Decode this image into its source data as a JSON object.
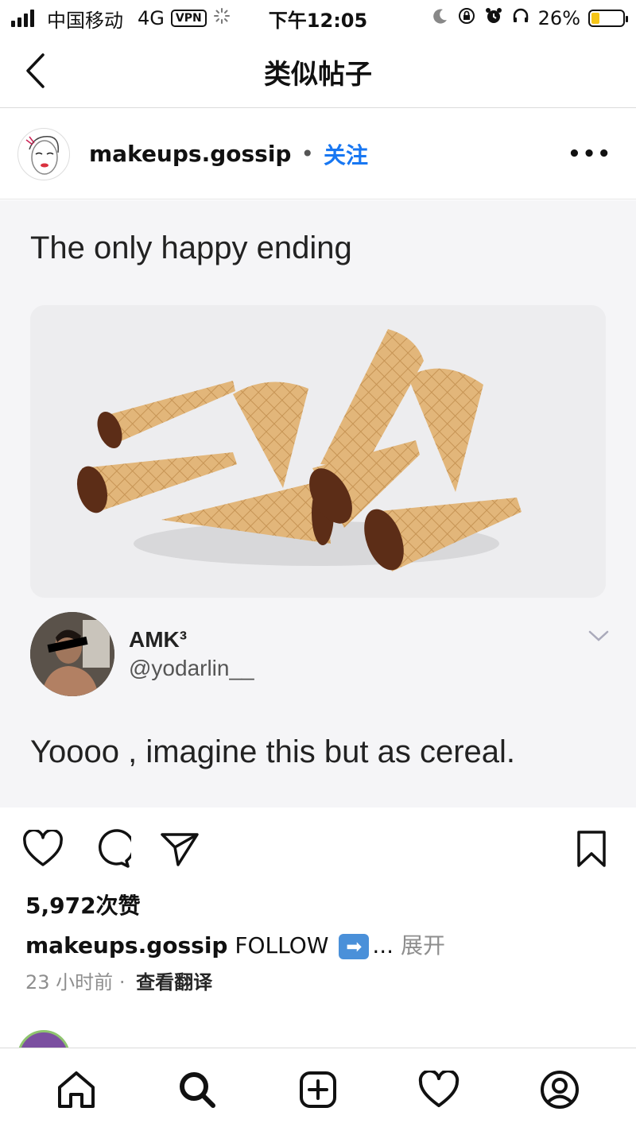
{
  "status_bar": {
    "carrier": "中国移动",
    "network": "4G",
    "vpn": "VPN",
    "time": "下午12:05",
    "battery_percent": "26%",
    "battery_level": 0.26,
    "icons": [
      "signal-icon",
      "loading-icon",
      "moon-icon",
      "rotation-lock-icon",
      "alarm-icon",
      "headphones-icon",
      "battery-icon"
    ]
  },
  "header": {
    "title": "类似帖子",
    "back_icon": "chevron-left-icon"
  },
  "post": {
    "username": "makeups.gossip",
    "separator": "•",
    "follow_label": "关注",
    "more_label": "•••",
    "tweet": {
      "text": "The only happy ending",
      "author_name": "AMK³",
      "author_handle": "@yodarlin__",
      "body": "Yoooo , imagine this but as cereal."
    },
    "likes": "5,972次赞",
    "caption_user": "makeups.gossip",
    "caption_text": "FOLLOW",
    "caption_arrow": "➡",
    "caption_ellipsis": "...",
    "caption_more": "展开",
    "time_ago": "23 小时前",
    "meta_separator": "·",
    "translate_label": "查看翻译"
  },
  "tab_bar": {
    "items": [
      "home-icon",
      "search-icon",
      "create-post-icon",
      "activity-heart-icon",
      "profile-icon"
    ]
  },
  "colors": {
    "accent": "#1877f2",
    "battery_fill": "#f5c518",
    "muted": "#8e8e8e"
  }
}
